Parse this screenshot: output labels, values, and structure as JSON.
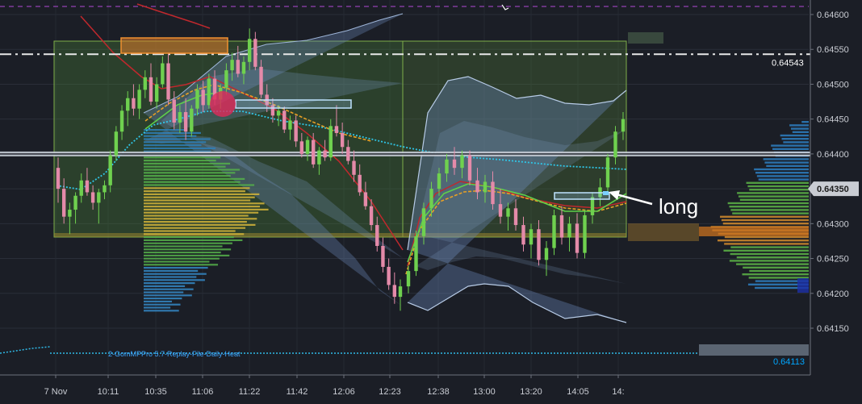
{
  "chart_data": {
    "type": "candlestick",
    "y_ticks": [
      "0.64600",
      "0.64550",
      "0.64500",
      "0.64450",
      "0.64400",
      "0.64350",
      "0.64300",
      "0.64250",
      "0.64200",
      "0.64150"
    ],
    "ylim": [
      0.64108,
      0.64614
    ],
    "x_ticks": [
      "7 Nov",
      "10:11",
      "10:35",
      "11:06",
      "11:22",
      "11:42",
      "12:06",
      "12:23",
      "12:38",
      "13:00",
      "13:20",
      "14:05",
      "14:"
    ],
    "dashed_level": {
      "value": 0.64543,
      "label": "0.64543"
    },
    "current_price": {
      "value": 0.6435,
      "label": "0.64350"
    },
    "bottom_level_label": "0.64113",
    "horizontal_level": 0.644,
    "annotation": "long",
    "footer": "2-GomMPPro 5.7-Replay-File-Daily-Heat",
    "candles": [
      [
        0.6438,
        0.64395,
        0.6433,
        0.6435
      ],
      [
        0.6435,
        0.64365,
        0.643,
        0.6431
      ],
      [
        0.6431,
        0.6433,
        0.64285,
        0.6432
      ],
      [
        0.6432,
        0.64345,
        0.643,
        0.6434
      ],
      [
        0.6434,
        0.64372,
        0.6433,
        0.64362
      ],
      [
        0.64362,
        0.6438,
        0.6434,
        0.64345
      ],
      [
        0.64345,
        0.64355,
        0.6432,
        0.6433
      ],
      [
        0.6433,
        0.6435,
        0.643,
        0.64345
      ],
      [
        0.64345,
        0.64362,
        0.64335,
        0.64355
      ],
      [
        0.64355,
        0.64405,
        0.64345,
        0.64398
      ],
      [
        0.64398,
        0.6444,
        0.6439,
        0.64432
      ],
      [
        0.64432,
        0.6447,
        0.6442,
        0.64462
      ],
      [
        0.64462,
        0.6449,
        0.6444,
        0.6448
      ],
      [
        0.6448,
        0.645,
        0.64455,
        0.64465
      ],
      [
        0.64465,
        0.645,
        0.6445,
        0.64492
      ],
      [
        0.64492,
        0.6452,
        0.6448,
        0.6451
      ],
      [
        0.6451,
        0.6453,
        0.6447,
        0.64475
      ],
      [
        0.64475,
        0.6451,
        0.64465,
        0.645
      ],
      [
        0.645,
        0.6454,
        0.64495,
        0.6453
      ],
      [
        0.6453,
        0.64545,
        0.6447,
        0.64478
      ],
      [
        0.64478,
        0.6449,
        0.64435,
        0.64445
      ],
      [
        0.64445,
        0.6447,
        0.6443,
        0.6446
      ],
      [
        0.6446,
        0.6448,
        0.6442,
        0.64432
      ],
      [
        0.64432,
        0.6447,
        0.64425,
        0.64465
      ],
      [
        0.64465,
        0.645,
        0.64455,
        0.64492
      ],
      [
        0.64492,
        0.64505,
        0.6446,
        0.6447
      ],
      [
        0.6447,
        0.64515,
        0.64465,
        0.64508
      ],
      [
        0.64508,
        0.6452,
        0.6447,
        0.64478
      ],
      [
        0.64478,
        0.645,
        0.64465,
        0.64495
      ],
      [
        0.64495,
        0.6453,
        0.64485,
        0.6452
      ],
      [
        0.6452,
        0.64545,
        0.64505,
        0.64535
      ],
      [
        0.64535,
        0.64555,
        0.6451,
        0.64515
      ],
      [
        0.64515,
        0.6454,
        0.645,
        0.64532
      ],
      [
        0.64532,
        0.6458,
        0.6452,
        0.64565
      ],
      [
        0.64565,
        0.64575,
        0.6452,
        0.64525
      ],
      [
        0.64525,
        0.64535,
        0.6448,
        0.64485
      ],
      [
        0.64485,
        0.645,
        0.6446,
        0.6447
      ],
      [
        0.6447,
        0.6448,
        0.64445,
        0.64455
      ],
      [
        0.64455,
        0.6447,
        0.6444,
        0.64462
      ],
      [
        0.64462,
        0.64468,
        0.6443,
        0.64435
      ],
      [
        0.64435,
        0.64455,
        0.6442,
        0.64448
      ],
      [
        0.64448,
        0.64455,
        0.6441,
        0.64418
      ],
      [
        0.64418,
        0.6443,
        0.64395,
        0.644
      ],
      [
        0.644,
        0.64425,
        0.6439,
        0.6442
      ],
      [
        0.6442,
        0.6443,
        0.6438,
        0.64385
      ],
      [
        0.64385,
        0.6441,
        0.6437,
        0.64405
      ],
      [
        0.64405,
        0.6442,
        0.6439,
        0.64395
      ],
      [
        0.64395,
        0.6445,
        0.6439,
        0.6444
      ],
      [
        0.6444,
        0.6447,
        0.64425,
        0.6443
      ],
      [
        0.6443,
        0.64445,
        0.644,
        0.6441
      ],
      [
        0.6441,
        0.6442,
        0.64385,
        0.6439
      ],
      [
        0.6439,
        0.64405,
        0.6436,
        0.6437
      ],
      [
        0.6437,
        0.64385,
        0.6434,
        0.64345
      ],
      [
        0.64345,
        0.6436,
        0.6432,
        0.64325
      ],
      [
        0.64325,
        0.64335,
        0.6429,
        0.64298
      ],
      [
        0.64298,
        0.6431,
        0.6426,
        0.64268
      ],
      [
        0.64268,
        0.6428,
        0.6423,
        0.64238
      ],
      [
        0.64238,
        0.6425,
        0.64205,
        0.64212
      ],
      [
        0.64212,
        0.6423,
        0.64185,
        0.64195
      ],
      [
        0.64195,
        0.6422,
        0.64175,
        0.6421
      ],
      [
        0.6421,
        0.6424,
        0.642,
        0.64232
      ],
      [
        0.64232,
        0.6429,
        0.64225,
        0.64282
      ],
      [
        0.64282,
        0.6433,
        0.6427,
        0.64322
      ],
      [
        0.64322,
        0.6436,
        0.6431,
        0.6435
      ],
      [
        0.6435,
        0.6438,
        0.6434,
        0.64372
      ],
      [
        0.64372,
        0.644,
        0.6436,
        0.64392
      ],
      [
        0.64392,
        0.6441,
        0.6437,
        0.6438
      ],
      [
        0.6438,
        0.64405,
        0.64365,
        0.64398
      ],
      [
        0.64398,
        0.64405,
        0.64355,
        0.64362
      ],
      [
        0.64362,
        0.6438,
        0.64335,
        0.64345
      ],
      [
        0.64345,
        0.6437,
        0.6433,
        0.6436
      ],
      [
        0.6436,
        0.64375,
        0.6432,
        0.64328
      ],
      [
        0.64328,
        0.6435,
        0.643,
        0.6431
      ],
      [
        0.6431,
        0.6433,
        0.6429,
        0.64322
      ],
      [
        0.64322,
        0.64335,
        0.6429,
        0.64298
      ],
      [
        0.64298,
        0.6431,
        0.6426,
        0.6427
      ],
      [
        0.6427,
        0.643,
        0.6425,
        0.64292
      ],
      [
        0.64292,
        0.64305,
        0.6424,
        0.64248
      ],
      [
        0.64248,
        0.64275,
        0.64225,
        0.64265
      ],
      [
        0.64265,
        0.6432,
        0.64255,
        0.64312
      ],
      [
        0.64312,
        0.64325,
        0.6427,
        0.6428
      ],
      [
        0.6428,
        0.6431,
        0.6426,
        0.643
      ],
      [
        0.643,
        0.64315,
        0.6425,
        0.64258
      ],
      [
        0.64258,
        0.6432,
        0.6425,
        0.64312
      ],
      [
        0.64312,
        0.64345,
        0.643,
        0.64338
      ],
      [
        0.64338,
        0.64365,
        0.64325,
        0.64352
      ],
      [
        0.64352,
        0.644,
        0.64345,
        0.64395
      ],
      [
        0.64395,
        0.6444,
        0.64385,
        0.64432
      ],
      [
        0.64432,
        0.6446,
        0.6442,
        0.6445
      ]
    ]
  }
}
